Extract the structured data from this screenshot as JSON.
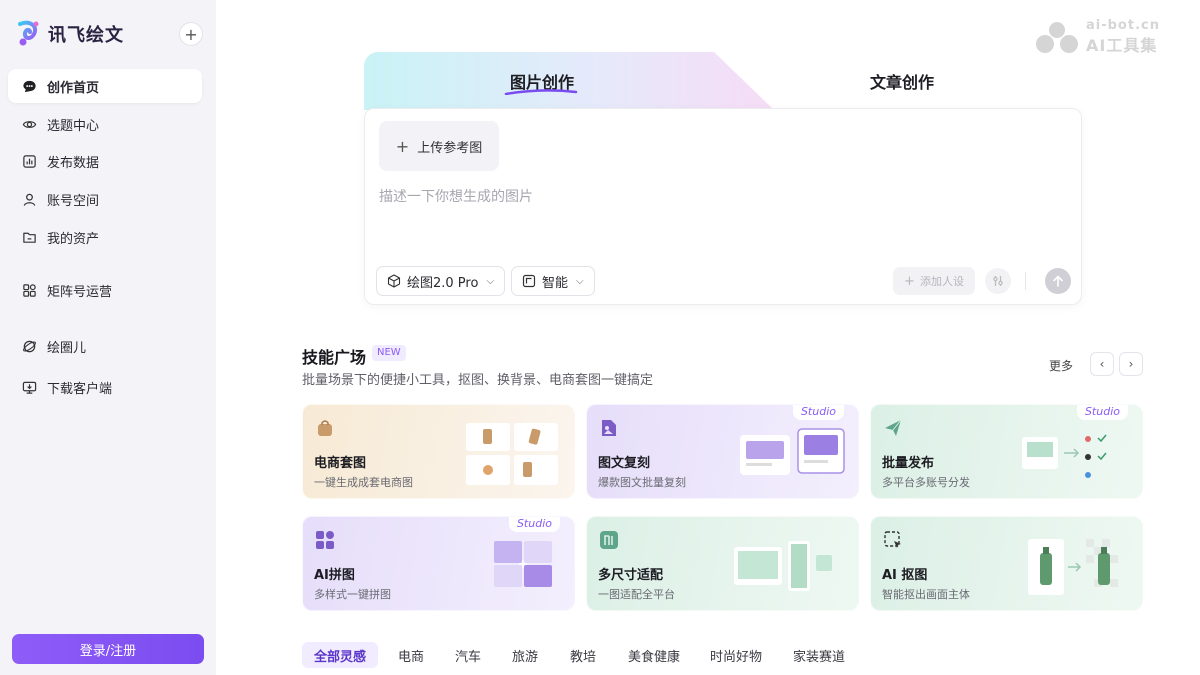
{
  "app": {
    "name": "讯飞绘文",
    "new_button": "+"
  },
  "watermark": {
    "line1": "ai-bot.cn",
    "line2": "AI工具集"
  },
  "sidebar": {
    "items": [
      {
        "label": "创作首页",
        "icon": "chat-bubble-icon",
        "active": true
      },
      {
        "label": "选题中心",
        "icon": "eye-icon"
      },
      {
        "label": "发布数据",
        "icon": "bar-chart-icon"
      },
      {
        "label": "账号空间",
        "icon": "user-icon"
      },
      {
        "label": "我的资产",
        "icon": "folder-icon"
      },
      {
        "label": "矩阵号运营",
        "icon": "grid-icon"
      },
      {
        "label": "绘圈儿",
        "icon": "orbit-icon"
      },
      {
        "label": "下载客户端",
        "icon": "monitor-icon"
      }
    ],
    "login_label": "登录/注册"
  },
  "tabs": {
    "image": "图片创作",
    "article": "文章创作",
    "active": "图片创作"
  },
  "prompt": {
    "upload_label": "上传参考图",
    "placeholder": "描述一下你想生成的图片",
    "model_label": "绘图2.0 Pro",
    "ratio_label": "智能",
    "persona_label": "添加人设"
  },
  "skills": {
    "title": "技能广场",
    "badge": "NEW",
    "subtitle": "批量场景下的便捷小工具，抠图、换背景、电商套图一键搞定",
    "more": "更多",
    "studio_label": "Studio",
    "cards": [
      {
        "title": "电商套图",
        "desc": "一键生成成套电商图",
        "icon": "shopping-bag-icon",
        "studio": false
      },
      {
        "title": "图文复刻",
        "desc": "爆款图文批量复刻",
        "icon": "image-doc-icon",
        "studio": true
      },
      {
        "title": "批量发布",
        "desc": "多平台多账号分发",
        "icon": "paper-plane-icon",
        "studio": true
      },
      {
        "title": "AI拼图",
        "desc": "多样式一键拼图",
        "icon": "collage-icon",
        "studio": true
      },
      {
        "title": "多尺寸适配",
        "desc": "一图适配全平台",
        "icon": "resize-icon",
        "studio": false
      },
      {
        "title": "AI 抠图",
        "desc": "智能抠出画面主体",
        "icon": "cutout-icon",
        "studio": false
      }
    ]
  },
  "categories": {
    "items": [
      "全部灵感",
      "电商",
      "汽车",
      "旅游",
      "教培",
      "美食健康",
      "时尚好物",
      "家装赛道"
    ],
    "active": "全部灵感"
  },
  "colors": {
    "accent": "#8a5cf5",
    "login_button": "#7b4cf0",
    "sidebar_bg": "#f4f3f7"
  }
}
